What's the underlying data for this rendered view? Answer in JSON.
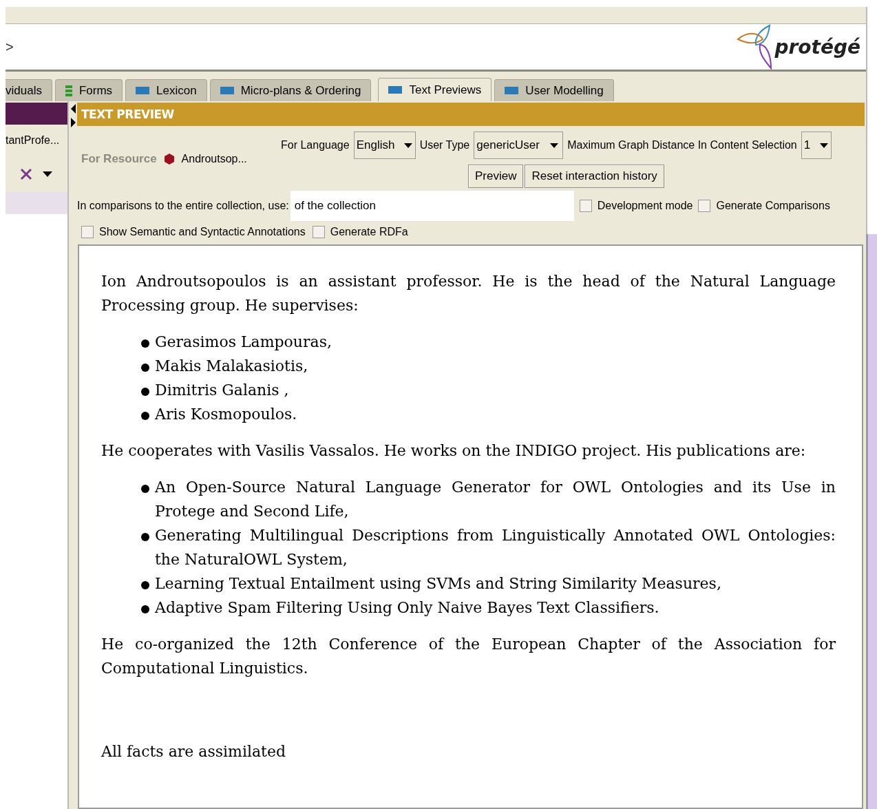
{
  "header": {
    "breadcrumb": ">",
    "logo_text": "protégé"
  },
  "tabs": [
    {
      "label": "viduals",
      "kind": "plain",
      "selected": false
    },
    {
      "label": "Forms",
      "kind": "form",
      "selected": false
    },
    {
      "label": "Lexicon",
      "kind": "view",
      "selected": false
    },
    {
      "label": "Micro-plans & Ordering",
      "kind": "view",
      "selected": false
    },
    {
      "label": "Text Previews",
      "kind": "view",
      "selected": true
    },
    {
      "label": "User Modelling",
      "kind": "view",
      "selected": false
    }
  ],
  "left_panel": {
    "item": "tantProfe..."
  },
  "panel": {
    "title": "TEXT PREVIEW",
    "for_resource_label": "For Resource",
    "resource_name": "Androutsop...",
    "for_language_label": "For Language",
    "language": "English",
    "user_type_label": "User Type",
    "user_type": "genericUser",
    "max_distance_label": "Maximum Graph Distance In Content Selection",
    "max_distance": "1",
    "buttons": [
      "Preview",
      "Reset interaction history"
    ],
    "comparisons_label": "In comparisons to the entire collection, use:",
    "comparisons_value": "of the collection",
    "options_row1": [
      {
        "label": "Development mode",
        "checked": false
      },
      {
        "label": "Generate Comparisons",
        "checked": false
      }
    ],
    "options_row2": [
      {
        "label": "Show Semantic and Syntactic Annotations",
        "checked": false
      },
      {
        "label": "Generate RDFa",
        "checked": false
      }
    ]
  },
  "preview": [
    {
      "kind": "paragraph",
      "text": "Ion Androutsopoulos is an assistant professor. He is the head of the Natural Language Processing group. He supervises:"
    },
    {
      "kind": "list",
      "items": [
        "Gerasimos Lampouras,",
        "Makis Malakasiotis,",
        "Dimitris Galanis ,",
        "Aris Kosmopoulos."
      ]
    },
    {
      "kind": "paragraph",
      "text": "He cooperates with Vasilis Vassalos. He works on the INDIGO project. His publications are:"
    },
    {
      "kind": "list",
      "items": [
        "An Open-Source Natural Language Generator for OWL Ontologies and its Use in Protege and Second Life,",
        "Generating Multilingual Descriptions from Linguistically Annotated OWL Ontologies: the NaturalOWL System,",
        "Learning Textual Entailment using SVMs and String Similarity Measures,",
        "Adaptive Spam Filtering Using Only Naive Bayes Text Classifiers."
      ]
    },
    {
      "kind": "paragraph",
      "text": "He co-organized the 12th Conference of the European Chapter of the Association for Computational Linguistics."
    },
    {
      "kind": "note",
      "text": "All facts are assimilated"
    }
  ]
}
